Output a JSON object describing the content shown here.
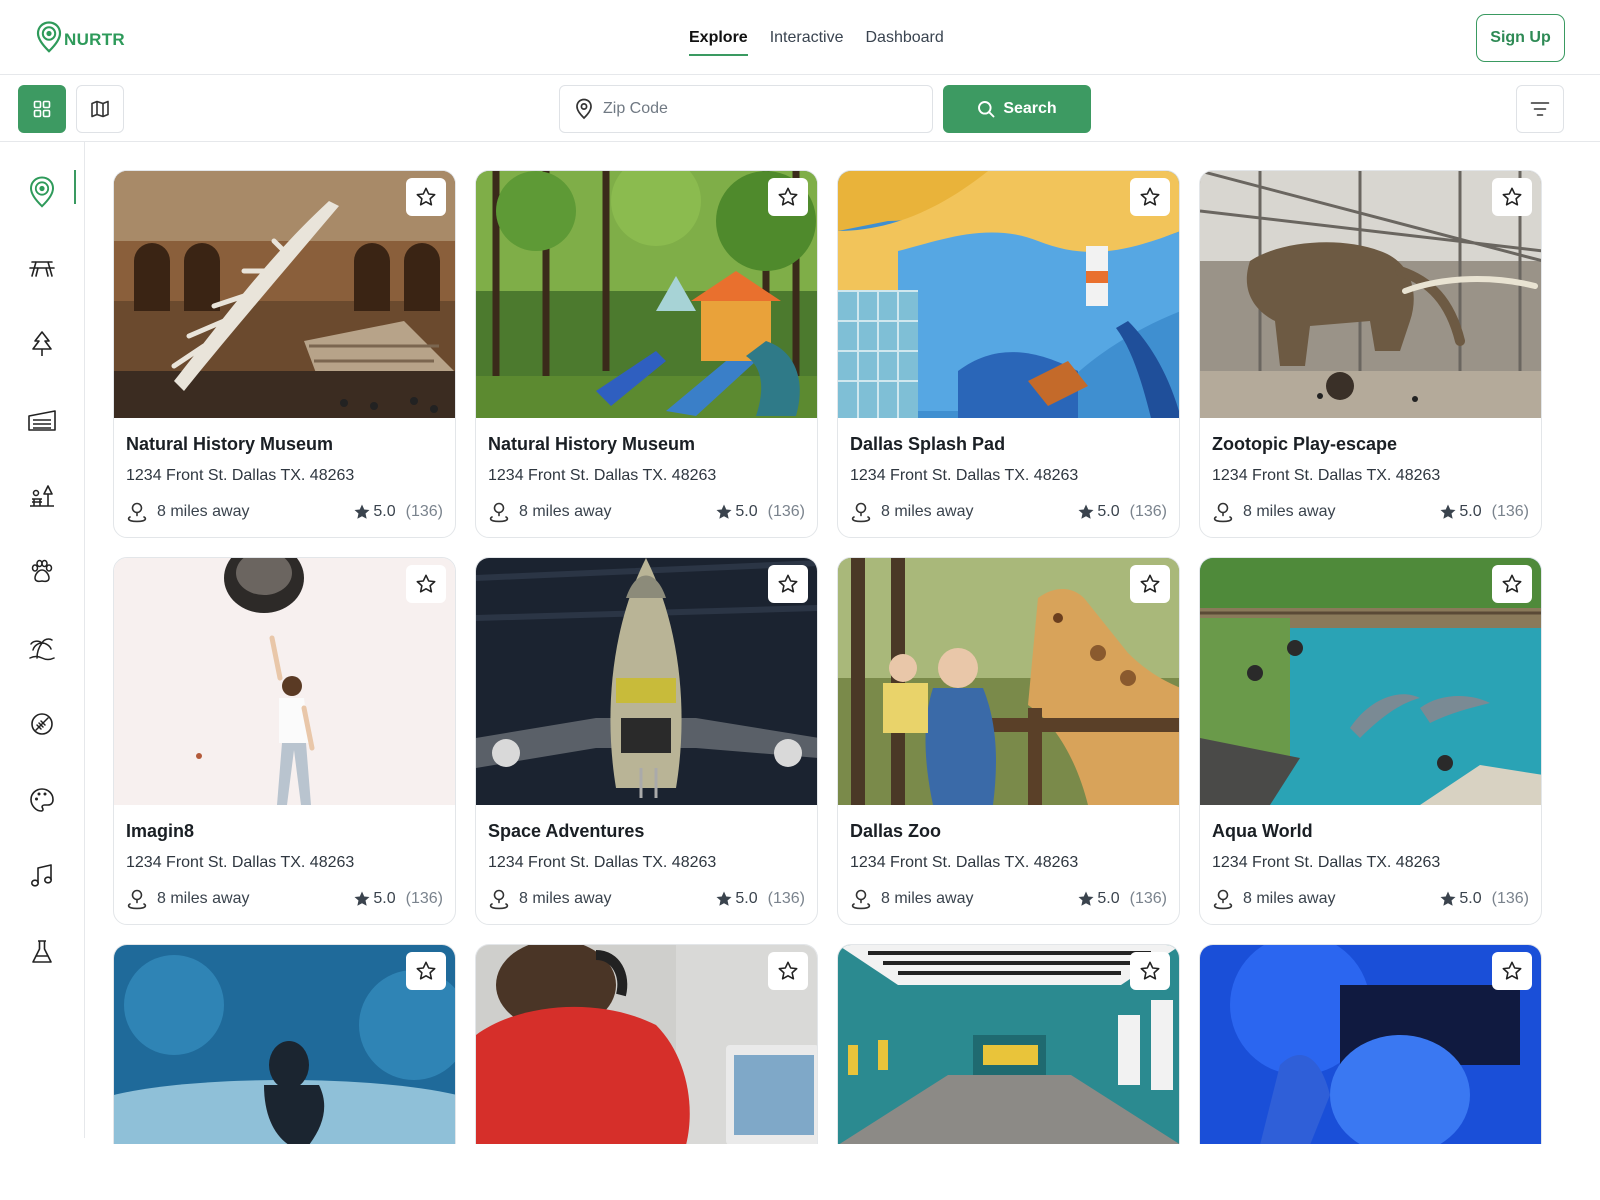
{
  "header": {
    "logo_text": "NURTR",
    "nav": [
      {
        "label": "Explore",
        "active": true
      },
      {
        "label": "Interactive",
        "active": false
      },
      {
        "label": "Dashboard",
        "active": false
      }
    ],
    "signup_label": "Sign Up"
  },
  "toolbar": {
    "zip_placeholder": "Zip Code",
    "search_label": "Search"
  },
  "sidebar": {
    "items": [
      {
        "icon": "location-pin-icon",
        "active": true
      },
      {
        "icon": "picnic-table-icon"
      },
      {
        "icon": "tree-icon"
      },
      {
        "icon": "indoor-venue-icon"
      },
      {
        "icon": "park-icon"
      },
      {
        "icon": "paw-icon"
      },
      {
        "icon": "beach-icon"
      },
      {
        "icon": "football-icon"
      },
      {
        "icon": "palette-icon"
      },
      {
        "icon": "music-note-icon"
      },
      {
        "icon": "science-flask-icon"
      }
    ]
  },
  "colors": {
    "accent": "#3d9a62",
    "brand_text": "#2e9a5a",
    "border": "#e3e6e9"
  },
  "cards": [
    {
      "title": "Natural History Museum",
      "address": "1234 Front St. Dallas TX. 48263",
      "distance": "8 miles away",
      "rating": "5.0",
      "count": "(136)"
    },
    {
      "title": "Natural History Museum",
      "address": "1234 Front St. Dallas TX. 48263",
      "distance": "8 miles away",
      "rating": "5.0",
      "count": "(136)"
    },
    {
      "title": "Dallas Splash Pad",
      "address": "1234 Front St. Dallas TX. 48263",
      "distance": "8 miles away",
      "rating": "5.0",
      "count": "(136)"
    },
    {
      "title": "Zootopic Play-escape",
      "address": "1234 Front St. Dallas TX. 48263",
      "distance": "8 miles away",
      "rating": "5.0",
      "count": "(136)"
    },
    {
      "title": "Imagin8",
      "address": "1234 Front St. Dallas TX. 48263",
      "distance": "8 miles away",
      "rating": "5.0",
      "count": "(136)"
    },
    {
      "title": "Space Adventures",
      "address": "1234 Front St. Dallas TX. 48263",
      "distance": "8 miles away",
      "rating": "5.0",
      "count": "(136)"
    },
    {
      "title": "Dallas Zoo",
      "address": "1234 Front St. Dallas TX. 48263",
      "distance": "8 miles away",
      "rating": "5.0",
      "count": "(136)"
    },
    {
      "title": "Aqua World",
      "address": "1234 Front St. Dallas TX. 48263",
      "distance": "8 miles away",
      "rating": "5.0",
      "count": "(136)"
    }
  ]
}
